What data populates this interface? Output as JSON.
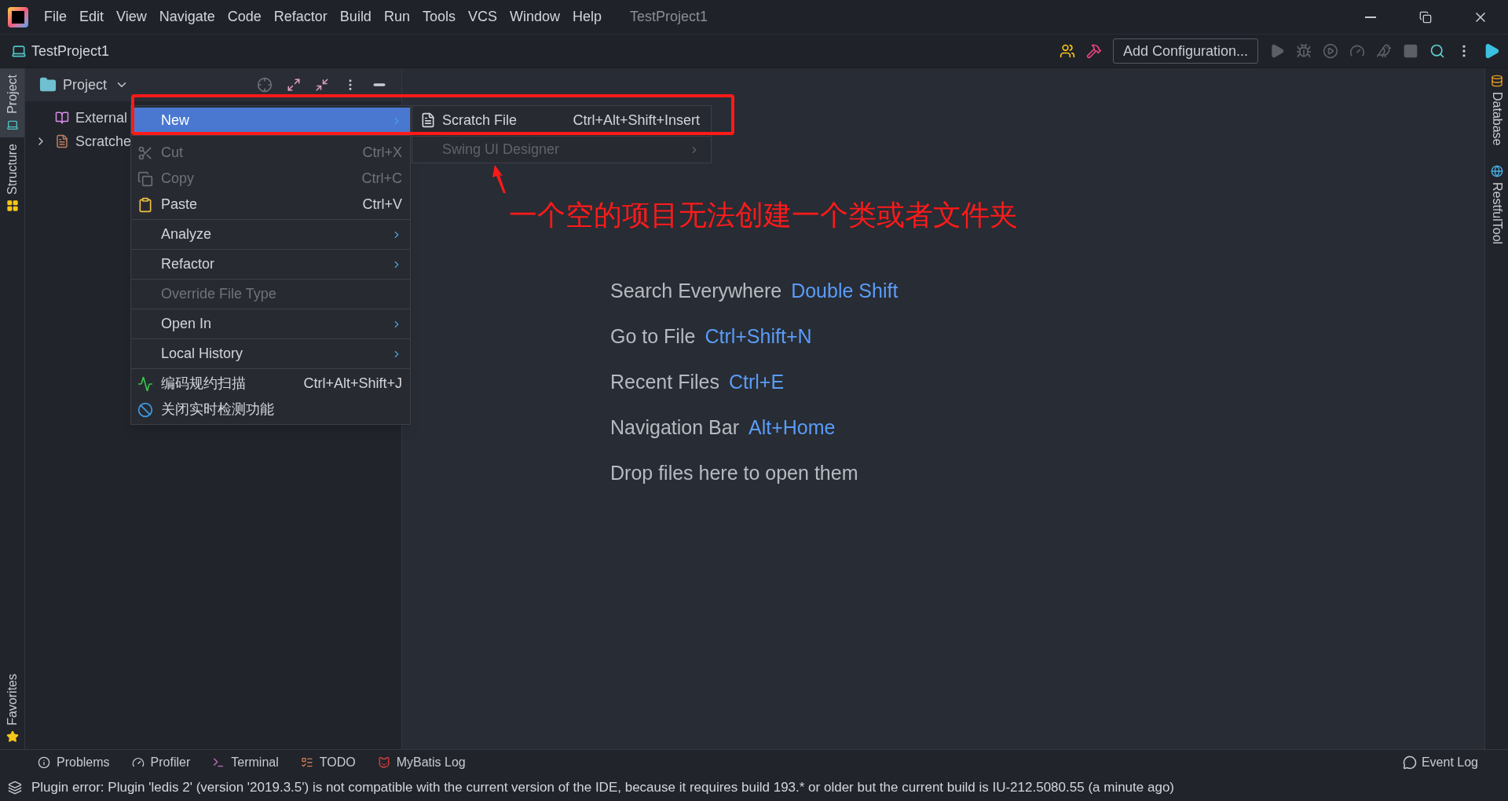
{
  "menu_bar": {
    "items": [
      "File",
      "Edit",
      "View",
      "Navigate",
      "Code",
      "Refactor",
      "Build",
      "Run",
      "Tools",
      "VCS",
      "Window",
      "Help"
    ],
    "title": "TestProject1"
  },
  "toolbar": {
    "project": "TestProject1",
    "run_config": "Add Configuration..."
  },
  "left_strip": [
    {
      "label": "Project",
      "selected": true
    },
    {
      "label": "Structure",
      "selected": false
    },
    {
      "label": "Favorites",
      "selected": false
    }
  ],
  "right_strip": [
    {
      "label": "Database"
    },
    {
      "label": "RestfulTool"
    }
  ],
  "project_panel": {
    "title": "Project",
    "tree": [
      {
        "label": "External",
        "expandable": false
      },
      {
        "label": "Scratche",
        "expandable": true
      }
    ]
  },
  "context_menu": {
    "groups": [
      [
        {
          "label": "New",
          "submenu": true,
          "selected": true,
          "disabled": false
        }
      ],
      [
        {
          "label": "Cut",
          "shortcut": "Ctrl+X",
          "disabled": true,
          "selected": false,
          "submenu": false
        },
        {
          "label": "Copy",
          "shortcut": "Ctrl+C",
          "disabled": true,
          "selected": false,
          "submenu": false
        },
        {
          "label": "Paste",
          "shortcut": "Ctrl+V",
          "disabled": false,
          "selected": false,
          "submenu": false
        }
      ],
      [
        {
          "label": "Analyze",
          "submenu": true,
          "disabled": false,
          "selected": false
        }
      ],
      [
        {
          "label": "Refactor",
          "submenu": true,
          "disabled": false,
          "selected": false
        }
      ],
      [
        {
          "label": "Override File Type",
          "disabled": true,
          "selected": false,
          "submenu": false
        }
      ],
      [
        {
          "label": "Open In",
          "submenu": true,
          "disabled": false,
          "selected": false
        }
      ],
      [
        {
          "label": "Local History",
          "submenu": true,
          "disabled": false,
          "selected": false
        }
      ],
      [
        {
          "label": "编码规约扫描",
          "shortcut": "Ctrl+Alt+Shift+J",
          "disabled": false,
          "selected": false,
          "submenu": false
        },
        {
          "label": "关闭实时检测功能",
          "disabled": false,
          "selected": false,
          "submenu": false
        }
      ]
    ]
  },
  "submenu": [
    {
      "label": "Scratch File",
      "shortcut": "Ctrl+Alt+Shift+Insert",
      "disabled": false,
      "submenu": false
    },
    {
      "label": "Swing UI Designer",
      "disabled": true,
      "submenu": true
    }
  ],
  "annotation": "一个空的项目无法创建一个类或者文件夹",
  "welcome": [
    {
      "label": "Search Everywhere",
      "shortcut": "Double Shift"
    },
    {
      "label": "Go to File",
      "shortcut": "Ctrl+Shift+N"
    },
    {
      "label": "Recent Files",
      "shortcut": "Ctrl+E"
    },
    {
      "label": "Navigation Bar",
      "shortcut": "Alt+Home"
    },
    {
      "label": "Drop files here to open them"
    }
  ],
  "bottom_tools": [
    "Problems",
    "Profiler",
    "Terminal",
    "TODO",
    "MyBatis Log"
  ],
  "event_log": "Event Log",
  "status": "Plugin error: Plugin 'ledis 2' (version '2019.3.5') is not compatible with the current version of the IDE, because it requires build 193.* or older but the current build is IU-212.5080.55 (a minute ago)"
}
